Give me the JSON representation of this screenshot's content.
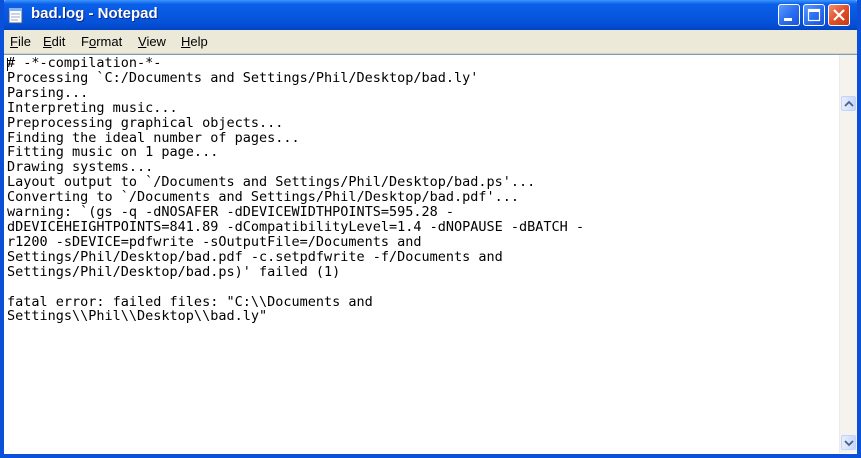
{
  "window": {
    "title": "bad.log - Notepad"
  },
  "menu": [
    {
      "accel": "F",
      "rest": "ile"
    },
    {
      "accel": "E",
      "rest": "dit"
    },
    {
      "accel": "o",
      "pre": "F",
      "rest": "rmat"
    },
    {
      "accel": "V",
      "rest": "iew"
    },
    {
      "accel": "H",
      "rest": "elp"
    }
  ],
  "document": {
    "content": "# -*-compilation-*-\nProcessing `C:/Documents and Settings/Phil/Desktop/bad.ly'\nParsing...\nInterpreting music...\nPreprocessing graphical objects...\nFinding the ideal number of pages...\nFitting music on 1 page...\nDrawing systems...\nLayout output to `/Documents and Settings/Phil/Desktop/bad.ps'...\nConverting to `/Documents and Settings/Phil/Desktop/bad.pdf'...\nwarning: `(gs -q -dNOSAFER -dDEVICEWIDTHPOINTS=595.28 -\ndDEVICEHEIGHTPOINTS=841.89 -dCompatibilityLevel=1.4 -dNOPAUSE -dBATCH -\nr1200 -sDEVICE=pdfwrite -sOutputFile=/Documents and\nSettings/Phil/Desktop/bad.pdf -c.setpdfwrite -f/Documents and\nSettings/Phil/Desktop/bad.ps)' failed (1)\n\nfatal error: failed files: \"C:\\\\Documents and\nSettings\\\\Phil\\\\Desktop\\\\bad.ly\""
  },
  "icons": {
    "app": "notepad-icon",
    "minimize": "minimize-icon",
    "maximize": "maximize-icon",
    "close": "close-icon",
    "scroll_up": "scroll-up-arrow-icon",
    "scroll_down": "scroll-down-arrow-icon"
  },
  "colors": {
    "titlebar": "#0758e0",
    "close_button": "#e0502a",
    "menubar": "#ece9d8"
  }
}
